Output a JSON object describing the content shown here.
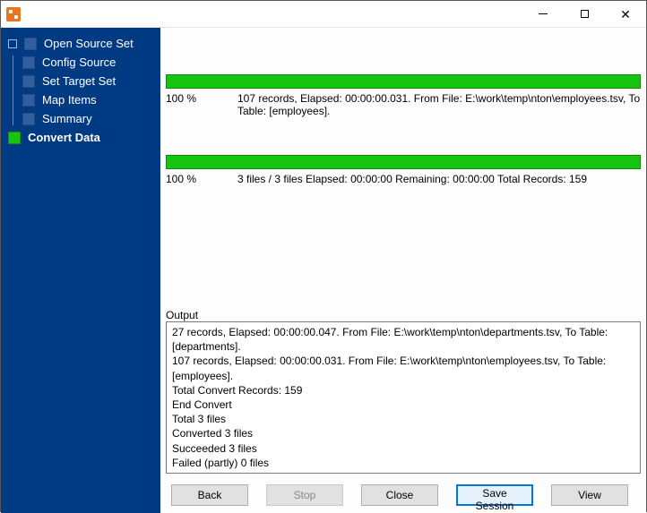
{
  "sidebar": {
    "root": "Open Source Set",
    "items": [
      {
        "label": "Config Source",
        "active": false
      },
      {
        "label": "Set Target Set",
        "active": false
      },
      {
        "label": "Map Items",
        "active": false
      },
      {
        "label": "Summary",
        "active": false
      }
    ],
    "final": {
      "label": "Convert Data",
      "active": true
    }
  },
  "progress1": {
    "percent": "100 %",
    "detail": "107 records,    Elapsed: 00:00:00.031.    From File: E:\\work\\temp\\nton\\employees.tsv,   To Table: [employees]."
  },
  "progress2": {
    "percent": "100 %",
    "detail": "3 files / 3 files    Elapsed: 00:00:00    Remaining: 00:00:00    Total Records: 159"
  },
  "output": {
    "label": "Output",
    "lines": [
      "27 records,    Elapsed: 00:00:00.047.    From File: E:\\work\\temp\\nton\\departments.tsv,    To Table: [departments].",
      "107 records,    Elapsed: 00:00:00.031.    From File: E:\\work\\temp\\nton\\employees.tsv,    To Table: [employees].",
      "Total Convert Records: 159",
      "End Convert",
      "Total 3 files",
      "Converted 3 files",
      "Succeeded 3 files",
      "Failed (partly) 0 files"
    ]
  },
  "buttons": {
    "back": "Back",
    "stop": "Stop",
    "close": "Close",
    "save": "Save Session",
    "view": "View"
  }
}
